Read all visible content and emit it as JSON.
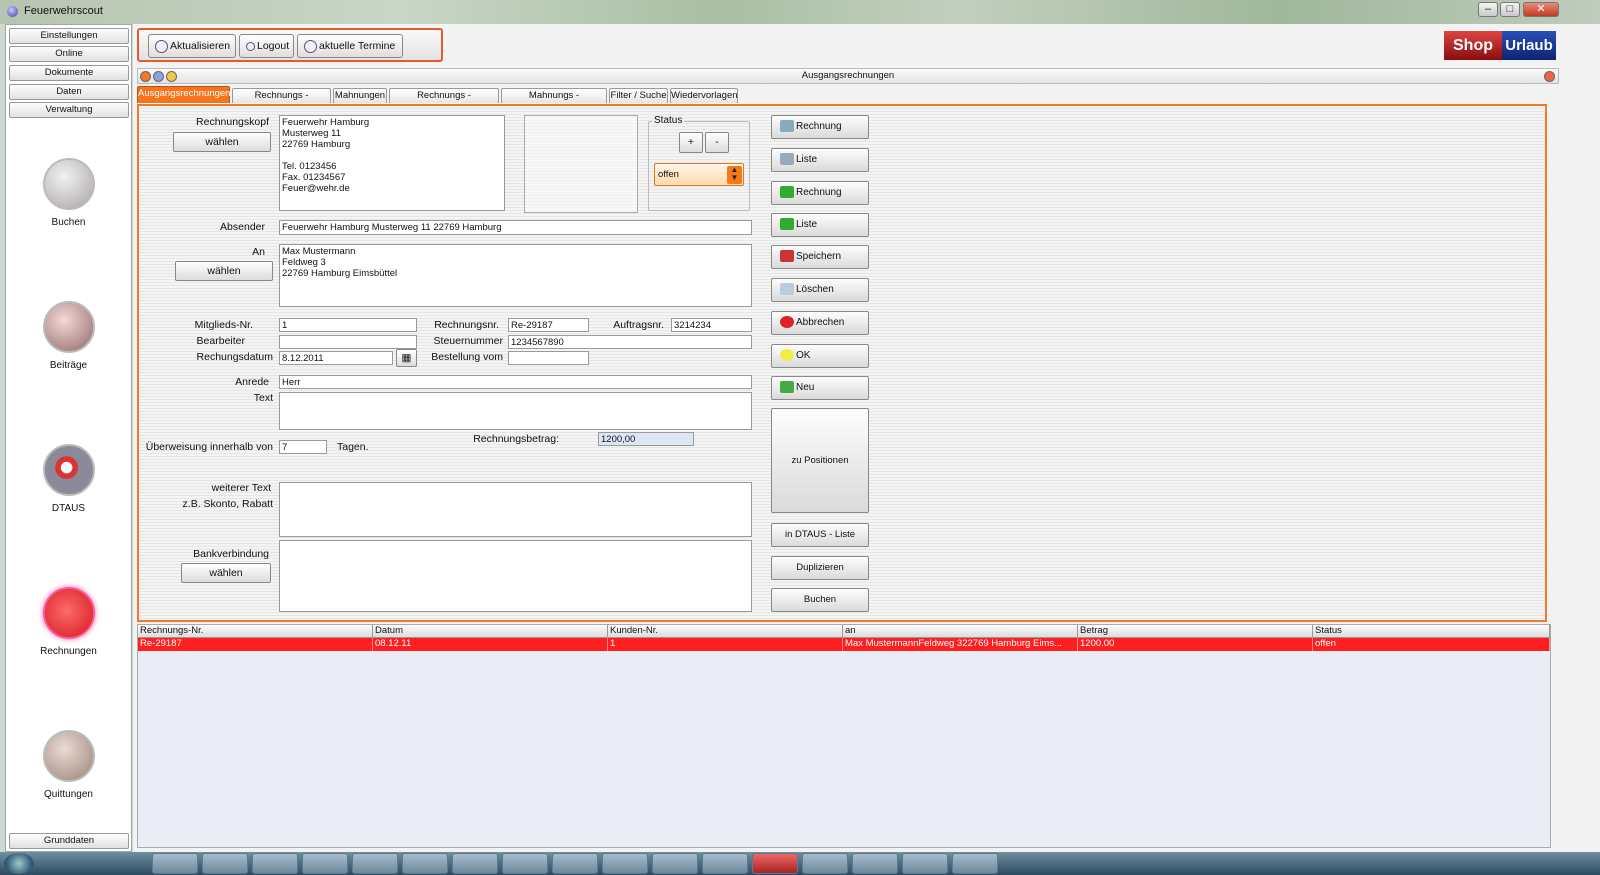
{
  "window": {
    "title": "Feuerwehrscout",
    "controls": [
      "–",
      "□",
      "✕"
    ]
  },
  "sidebar": {
    "menu": [
      "Einstellungen",
      "Online",
      "Dokumente",
      "Daten",
      "Verwaltung"
    ],
    "nav": [
      {
        "label": "Buchen",
        "icon": "book-icon"
      },
      {
        "label": "Beiträge",
        "icon": "gauge-icon"
      },
      {
        "label": "DTAUS",
        "icon": "disc-icon"
      },
      {
        "label": "Rechnungen",
        "icon": "invoice-icon"
      },
      {
        "label": "Quittungen",
        "icon": "receipt-icon"
      }
    ],
    "bottom": "Grunddaten"
  },
  "toolbar": {
    "refresh": "Aktualisieren",
    "logout": "Logout",
    "appointments": "aktuelle Termine"
  },
  "shop": {
    "left": "Shop",
    "right": "Urlaub"
  },
  "panel": {
    "title": "Ausgangsrechnungen"
  },
  "tabs": [
    "Ausgangsrechnungen",
    "Rechnungs - Positionen",
    "Mahnungen",
    "Rechnungs - Einstellungen",
    "Mahnungs - Einstellungen",
    "Filter / Suche",
    "Wiedervorlagen"
  ],
  "form": {
    "rechnungskopf_label": "Rechnungskopf",
    "waehlen": "wählen",
    "rechnungskopf": "Feuerwehr Hamburg\nMusterweg 11\n22769 Hamburg\n\nTel. 0123456\nFax. 01234567\nFeuer@wehr.de",
    "status_label": "Status",
    "plus": "+",
    "minus": "-",
    "status_value": "offen",
    "absender_label": "Absender",
    "absender": "Feuerwehr Hamburg Musterweg 11 22769 Hamburg",
    "an_label": "An",
    "an": "Max Mustermann\nFeldweg 3\n22769 Hamburg Eimsbüttel",
    "mitglied_label": "Mitglieds-Nr.",
    "mitglied": "1",
    "rechnungsnr_label": "Rechnungsnr.",
    "rechnungsnr": "Re-29187",
    "auftragsnr_label": "Auftragsnr.",
    "auftragsnr": "3214234",
    "bearbeiter_label": "Bearbeiter",
    "bearbeiter": "",
    "steuernummer_label": "Steuernummer",
    "steuernummer": "1234567890",
    "datum_label": "Rechungsdatum",
    "datum": "8.12.2011",
    "bestellung_label": "Bestellung vom",
    "bestellung": "",
    "anrede_label": "Anrede",
    "anrede": "Herr",
    "text_label": "Text",
    "text": "",
    "ueberweisung_label": "Überweisung innerhalb von",
    "ueberweisung": "7",
    "tage_label": "Tagen.",
    "betrag_label": "Rechnungsbetrag:",
    "betrag": "1200,00",
    "weiterer_label": "weiterer Text",
    "skonto_label": "z.B. Skonto, Rabatt",
    "weiterer": "",
    "bank_label": "Bankverbindung",
    "bank": ""
  },
  "actions": {
    "rechnung1": "Rechnung",
    "liste1": "Liste",
    "rechnung2": "Rechnung",
    "liste2": "Liste",
    "speichern": "Speichern",
    "loeschen": "Löschen",
    "abbrechen": "Abbrechen",
    "ok": "OK",
    "neu": "Neu",
    "positionen": "zu Positionen",
    "dtaus": "in DTAUS - Liste",
    "duplizieren": "Duplizieren",
    "buchen": "Buchen"
  },
  "table": {
    "headers": [
      "Rechnungs-Nr.",
      "Datum",
      "Kunden-Nr.",
      "an",
      "Betrag",
      "Status"
    ],
    "rows": [
      [
        "Re-29187",
        "08.12.11",
        "1",
        "Max MustermannFeldweg 322769 Hamburg Eims...",
        "1200.00",
        "offen"
      ]
    ]
  }
}
